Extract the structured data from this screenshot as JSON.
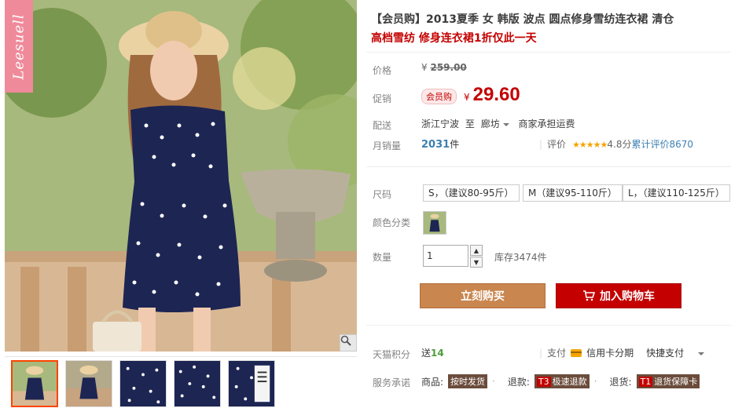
{
  "brand": {
    "logo_text": "Leesuell"
  },
  "product": {
    "title": "【会员购】2013夏季 女 韩版 波点 圆点修身雪纺连衣裙 清仓",
    "subtitle": "高档雪纺 修身连衣裙1折仅此一天"
  },
  "price": {
    "label": "价格",
    "currency": "¥",
    "original": "259.00",
    "promo_label": "促销",
    "promo_badge": "会员购",
    "promo_value": "29.60"
  },
  "delivery": {
    "label": "配送",
    "from": "浙江宁波",
    "to_word": "至",
    "destination": "廊坊",
    "fee_text": "商家承担运费"
  },
  "sales": {
    "label": "月销量",
    "count": "2031",
    "unit": "件",
    "rating_label": "评价",
    "stars": "★★★★★",
    "score": "4.8分",
    "total_reviews": "累计评价8670"
  },
  "sku": {
    "size_label": "尺码",
    "sizes": [
      "S，（建议80-95斤）",
      "M（建议95-110斤）",
      "L，（建议110-125斤）"
    ],
    "color_label": "颜色分类",
    "qty_label": "数量",
    "qty_value": "1",
    "stock_text": "库存3474件"
  },
  "actions": {
    "buy_now": "立刻购买",
    "add_cart": "加入购物车"
  },
  "extras": {
    "points_label": "天猫积分",
    "points_prefix": "送",
    "points_value": "14",
    "pay_label": "支付",
    "pay_option1": "信用卡分期",
    "pay_option2": "快捷支付",
    "service_label": "服务承诺",
    "service_goods_label": "商品:",
    "service_goods_tag": "按时发货",
    "service_refund_label": "退款:",
    "service_refund_code": "T3",
    "service_refund_tag": "极速退款",
    "service_return_label": "退货:",
    "service_return_code": "T1",
    "service_return_tag": "退货保障卡"
  },
  "colors": {
    "accent_red": "#c40000",
    "buy_orange": "#c9864f",
    "dress_navy": "#1d2553"
  }
}
